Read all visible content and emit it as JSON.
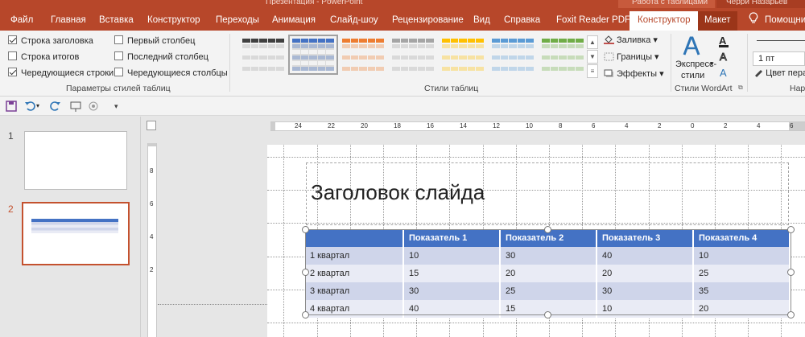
{
  "title_bar_fragments": {
    "left": "Презентация - PowerPoint",
    "ctx_a": "Работа с таблицами",
    "ctx_b": "Черри Назарьев"
  },
  "tabs": [
    {
      "label": "Файл"
    },
    {
      "label": "Главная"
    },
    {
      "label": "Вставка"
    },
    {
      "label": "Конструктор"
    },
    {
      "label": "Переходы"
    },
    {
      "label": "Анимация"
    },
    {
      "label": "Слайд-шоу"
    },
    {
      "label": "Рецензирование"
    },
    {
      "label": "Вид"
    },
    {
      "label": "Справка"
    },
    {
      "label": "Foxit Reader PDF"
    },
    {
      "label": "Конструктор"
    },
    {
      "label": "Макет"
    },
    {
      "label": "Помощни"
    }
  ],
  "style_options": {
    "header_row": {
      "label": "Строка заголовка",
      "checked": true
    },
    "total_row": {
      "label": "Строка итогов",
      "checked": false
    },
    "banded_rows": {
      "label": "Чередующиеся строки",
      "checked": true
    },
    "first_column": {
      "label": "Первый столбец",
      "checked": false
    },
    "last_column": {
      "label": "Последний столбец",
      "checked": false
    },
    "banded_columns": {
      "label": "Чередующиеся столбцы",
      "checked": false
    },
    "group_label": "Параметры стилей таблиц"
  },
  "table_styles": {
    "group_label": "Стили таблиц",
    "swatch_colors": [
      "#404040",
      "#4472c4",
      "#ed7d31",
      "#a5a5a5",
      "#ffc000",
      "#5b9bd5",
      "#70ad47"
    ],
    "selected_index": 1
  },
  "shading": {
    "fill_label": "Заливка",
    "borders_label": "Границы",
    "effects_label": "Эффекты"
  },
  "wordart": {
    "quick_styles_line1": "Экспресс-",
    "quick_styles_line2": "стили",
    "group_label": "Стили WordArt"
  },
  "draw_borders": {
    "pen_weight": "1 пт",
    "pen_color_label": "Цвет пера",
    "group_label": "Нари"
  },
  "qat": {
    "icons": [
      "save-icon",
      "undo-icon",
      "redo-icon",
      "start-from-beginning-icon",
      "touch-mode-icon",
      "customize-qat-icon"
    ]
  },
  "slides": [
    {
      "number": "1"
    },
    {
      "number": "2"
    }
  ],
  "rulers": {
    "horizontal": [
      "24",
      "22",
      "20",
      "18",
      "16",
      "14",
      "12",
      "10",
      "8",
      "6",
      "4",
      "2",
      "0",
      "2",
      "4",
      "6"
    ],
    "vertical": [
      "8",
      "6",
      "4",
      "2"
    ]
  },
  "slide": {
    "title": "Заголовок слайда",
    "table": {
      "headers": [
        "",
        "Показатель 1",
        "Показатель 2",
        "Показатель 3",
        "Показатель 4"
      ],
      "rows": [
        [
          "1 квартал",
          "10",
          "30",
          "40",
          "10"
        ],
        [
          "2 квартал",
          "15",
          "20",
          "20",
          "25"
        ],
        [
          "3 квартал",
          "30",
          "25",
          "30",
          "35"
        ],
        [
          "4 квартал",
          "40",
          "15",
          "10",
          "20"
        ]
      ]
    }
  }
}
